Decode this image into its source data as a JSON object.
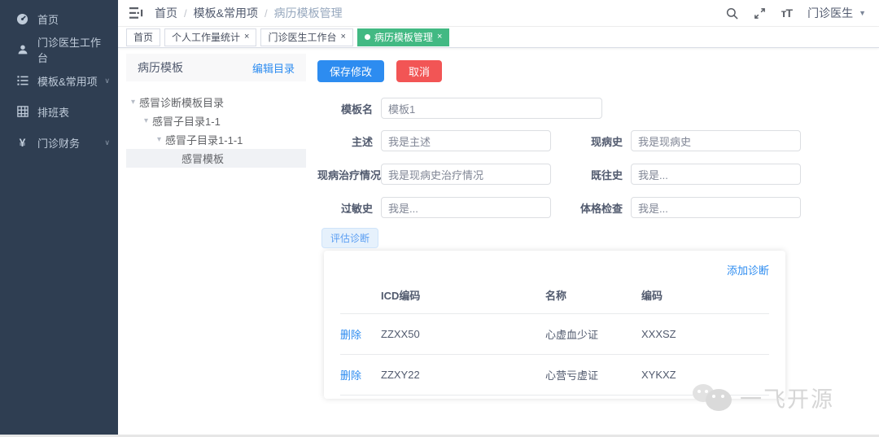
{
  "colors": {
    "primary_blue": "#2d8cf0",
    "danger_red": "#f25555",
    "active_tag_green": "#42b983",
    "sidebar_bg": "#2f3e52",
    "sidebar_text": "#bfcbd9"
  },
  "sidebar": {
    "items": [
      {
        "label": "首页",
        "icon": "home-dashboard-icon",
        "has_children": false
      },
      {
        "label": "门诊医生工作台",
        "icon": "doctor-workbench-icon",
        "has_children": false
      },
      {
        "label": "模板&常用项",
        "icon": "template-items-icon",
        "has_children": true
      },
      {
        "label": "排班表",
        "icon": "schedule-table-icon",
        "has_children": false
      },
      {
        "label": "门诊财务",
        "icon": "yuan-finance-icon",
        "has_children": true
      }
    ],
    "expand_glyph": "∨",
    "yuan_glyph": "¥"
  },
  "navbar": {
    "breadcrumb": {
      "items": [
        "首页",
        "模板&常用项",
        "病历模板管理"
      ],
      "separator": "/"
    },
    "font_size_icon_text": "тT",
    "user_name": "门诊医生",
    "user_caret_glyph": "▼"
  },
  "tags_view": {
    "close_glyph": "×",
    "tabs": [
      {
        "label": "首页",
        "closable": false,
        "active": false
      },
      {
        "label": "个人工作量统计",
        "closable": true,
        "active": false
      },
      {
        "label": "门诊医生工作台",
        "closable": true,
        "active": false
      },
      {
        "label": "病历模板管理",
        "closable": true,
        "active": true
      }
    ]
  },
  "template_panel": {
    "title": "病历模板",
    "edit_link": "编辑目录",
    "caret_glyph": "▾",
    "tree": [
      {
        "label": "感冒诊断模板目录",
        "level": 0,
        "expanded": true,
        "selected": false
      },
      {
        "label": "感冒子目录1-1",
        "level": 1,
        "expanded": true,
        "selected": false
      },
      {
        "label": "感冒子目录1-1-1",
        "level": 2,
        "expanded": true,
        "selected": false
      },
      {
        "label": "感冒模板",
        "level": 3,
        "expanded": null,
        "selected": true
      }
    ]
  },
  "form": {
    "save_button": "保存修改",
    "cancel_button": "取消",
    "fields": {
      "template_name": {
        "label": "模板名",
        "value": "模板1"
      },
      "chief_complaint": {
        "label": "主述",
        "value": "我是主述"
      },
      "present_illness": {
        "label": "现病史",
        "value": "我是现病史"
      },
      "present_treatment": {
        "label": "现病治疗情况",
        "value": "我是现病史治疗情况"
      },
      "past_history": {
        "label": "既往史",
        "value": "我是..."
      },
      "allergy_history": {
        "label": "过敏史",
        "value": "我是..."
      },
      "physical_exam": {
        "label": "体格检查",
        "value": "我是..."
      }
    }
  },
  "diagnosis_section": {
    "tab_label": "评估诊断",
    "add_link": "添加诊断",
    "table": {
      "headers": [
        "",
        "ICD编码",
        "名称",
        "编码"
      ],
      "rows": [
        {
          "action": "删除",
          "icd_code": "ZZXX50",
          "name": "心虚血少证",
          "code": "XXXSZ"
        },
        {
          "action": "删除",
          "icd_code": "ZZXY22",
          "name": "心营亏虚证",
          "code": "XYKXZ"
        }
      ]
    }
  },
  "watermark": {
    "text": "一飞开源"
  }
}
